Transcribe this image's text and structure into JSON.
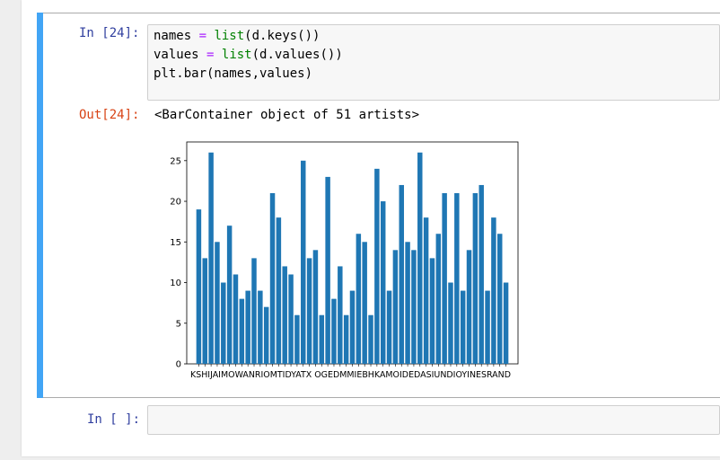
{
  "cells": [
    {
      "prompt": "In [24]:",
      "code_lines": [
        {
          "parts": [
            {
              "t": "names ",
              "c": ""
            },
            {
              "t": "=",
              "c": "kw-op"
            },
            {
              "t": " ",
              "c": ""
            },
            {
              "t": "list",
              "c": "builtin"
            },
            {
              "t": "(d.keys())",
              "c": ""
            }
          ]
        },
        {
          "parts": [
            {
              "t": "values ",
              "c": ""
            },
            {
              "t": "=",
              "c": "kw-op"
            },
            {
              "t": " ",
              "c": ""
            },
            {
              "t": "list",
              "c": "builtin"
            },
            {
              "t": "(d.values())",
              "c": ""
            }
          ]
        },
        {
          "parts": [
            {
              "t": "plt.bar(names,values)",
              "c": ""
            }
          ]
        }
      ],
      "out_prompt": "Out[24]:",
      "out_text": "<BarContainer object of 51 artists>"
    },
    {
      "prompt": "In [ ]:",
      "code_lines": []
    }
  ],
  "chart_data": {
    "type": "bar",
    "title": "",
    "xlabel": "",
    "ylabel": "",
    "ylim": [
      0,
      27.3
    ],
    "yticks": [
      0,
      5,
      10,
      15,
      20,
      25
    ],
    "xtick_text": "KSHIJAIMOWANRIOMTIDYATX OGEDMMIEBHKAMOIDEDASIUNDIOYINESRAND",
    "values": [
      19,
      13,
      26,
      15,
      10,
      17,
      11,
      8,
      9,
      13,
      9,
      7,
      21,
      18,
      12,
      11,
      6,
      25,
      13,
      14,
      6,
      23,
      8,
      12,
      6,
      9,
      16,
      15,
      6,
      24,
      20,
      9,
      14,
      22,
      15,
      14,
      26,
      18,
      13,
      16,
      21,
      10,
      21,
      9,
      14,
      21,
      22,
      9,
      18,
      16,
      10
    ],
    "bar_color": "#1f77b4"
  }
}
